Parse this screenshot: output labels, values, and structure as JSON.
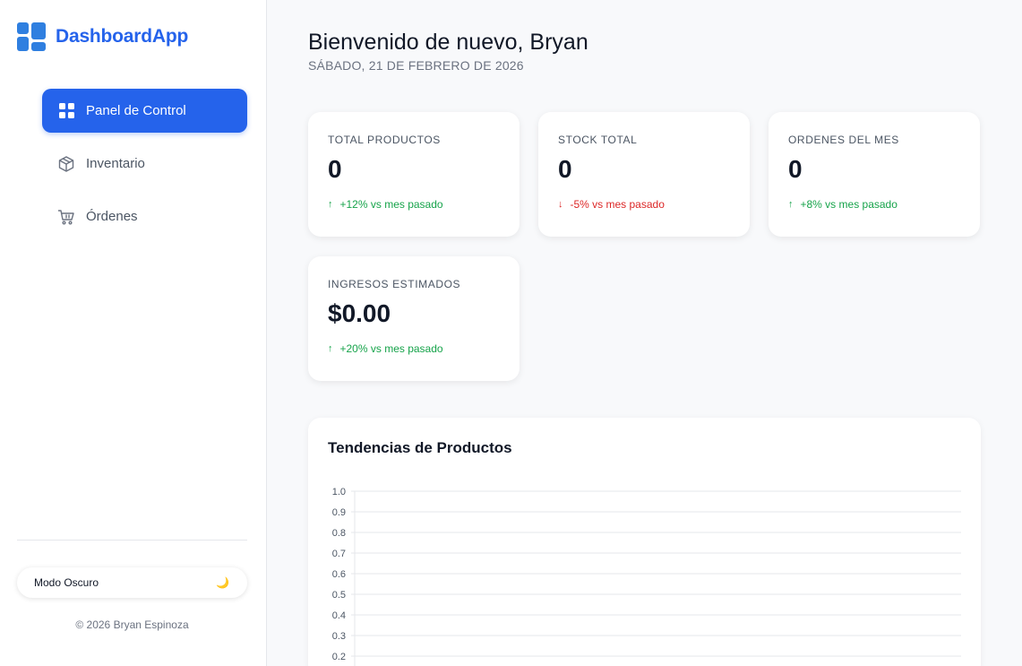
{
  "sidebar": {
    "brand": "DashboardApp",
    "nav": [
      {
        "label": "Panel de Control",
        "icon": "grid-icon",
        "active": true
      },
      {
        "label": "Inventario",
        "icon": "box-icon",
        "active": false
      },
      {
        "label": "Órdenes",
        "icon": "cart-icon",
        "active": false
      }
    ],
    "dark_mode_label": "Modo Oscuro",
    "dark_mode_icon": "moon-icon",
    "footer": "© 2026 Bryan Espinoza"
  },
  "header": {
    "welcome": "Bienvenido de nuevo, Bryan",
    "date": "SÁBADO, 21 DE FEBRERO DE 2026"
  },
  "stats": [
    {
      "label": "TOTAL PRODUCTOS",
      "value": "0",
      "trend": "+12% vs mes pasado",
      "direction": "up"
    },
    {
      "label": "STOCK TOTAL",
      "value": "0",
      "trend": "-5% vs mes pasado",
      "direction": "down"
    },
    {
      "label": "ORDENES DEL MES",
      "value": "0",
      "trend": "+8% vs mes pasado",
      "direction": "up"
    },
    {
      "label": "INGRESOS ESTIMADOS",
      "value": "$0.00",
      "trend": "+20% vs mes pasado",
      "direction": "up"
    }
  ],
  "colors": {
    "accent": "#2563eb",
    "up": "#16a34a",
    "down": "#dc2626"
  },
  "chart": {
    "title": "Tendencias de Productos"
  },
  "chart_data": {
    "type": "line",
    "title": "Tendencias de Productos",
    "xlabel": "",
    "ylabel": "",
    "ylim": [
      0,
      1.0
    ],
    "yticks": [
      "1.0",
      "0.9",
      "0.8",
      "0.7",
      "0.6",
      "0.5",
      "0.4",
      "0.3",
      "0.2"
    ],
    "series": [],
    "grid": true
  }
}
